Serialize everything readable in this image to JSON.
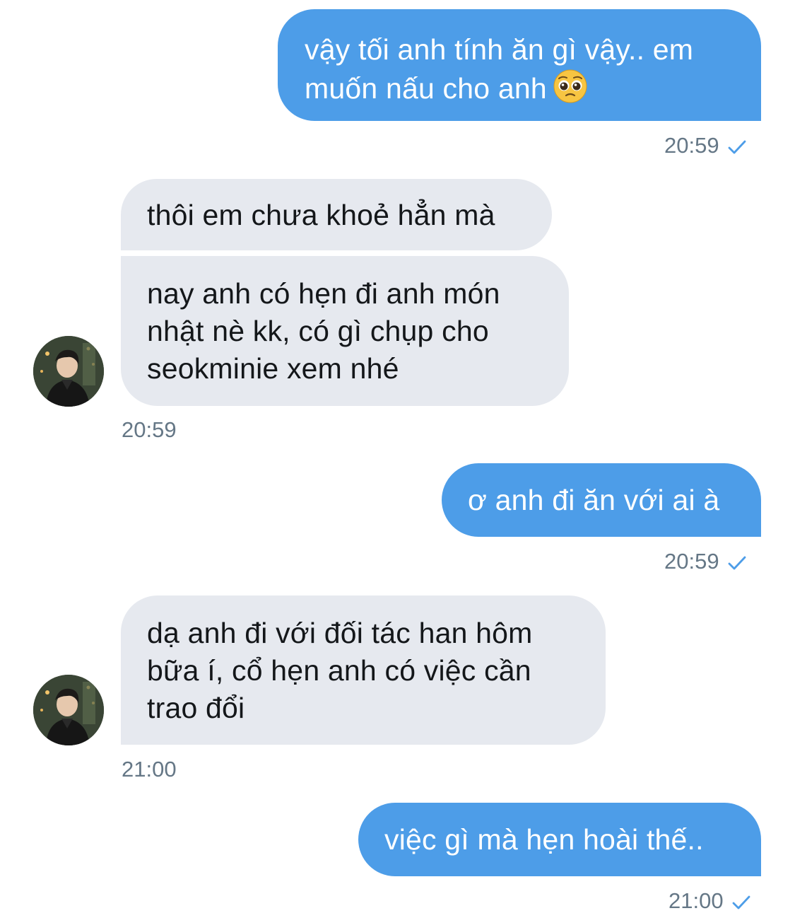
{
  "messages": [
    {
      "dir": "out",
      "lines": [
        "vậy tối anh tính ăn gì vậy.. em",
        "muốn nấu cho anh"
      ],
      "emoji": "pleading-face-emoji",
      "time": "20:59"
    },
    {
      "dir": "in",
      "lines": [
        "thôi em chưa khoẻ hẳn mà"
      ]
    },
    {
      "dir": "in",
      "lines": [
        "nay anh có hẹn đi anh món",
        "nhật nè kk, có gì chụp cho",
        "seokminie xem nhé"
      ],
      "time": "20:59"
    },
    {
      "dir": "out",
      "lines": [
        "ơ anh đi ăn với ai à"
      ],
      "time": "20:59"
    },
    {
      "dir": "in",
      "lines": [
        "dạ anh đi với đối tác han hôm",
        "bữa í, cổ hẹn anh có việc cần",
        "trao đổi"
      ],
      "time": "21:00"
    },
    {
      "dir": "out",
      "lines": [
        "việc gì mà hẹn hoài thế.."
      ],
      "time": "21:00"
    }
  ],
  "colors": {
    "outgoing_bubble": "#4d9de8",
    "incoming_bubble": "#e6e9ef",
    "timestamp": "#657786",
    "read_check": "#4d9de8"
  },
  "icons": {
    "read_receipt": "check-icon",
    "emoji": "pleading-face-emoji"
  }
}
